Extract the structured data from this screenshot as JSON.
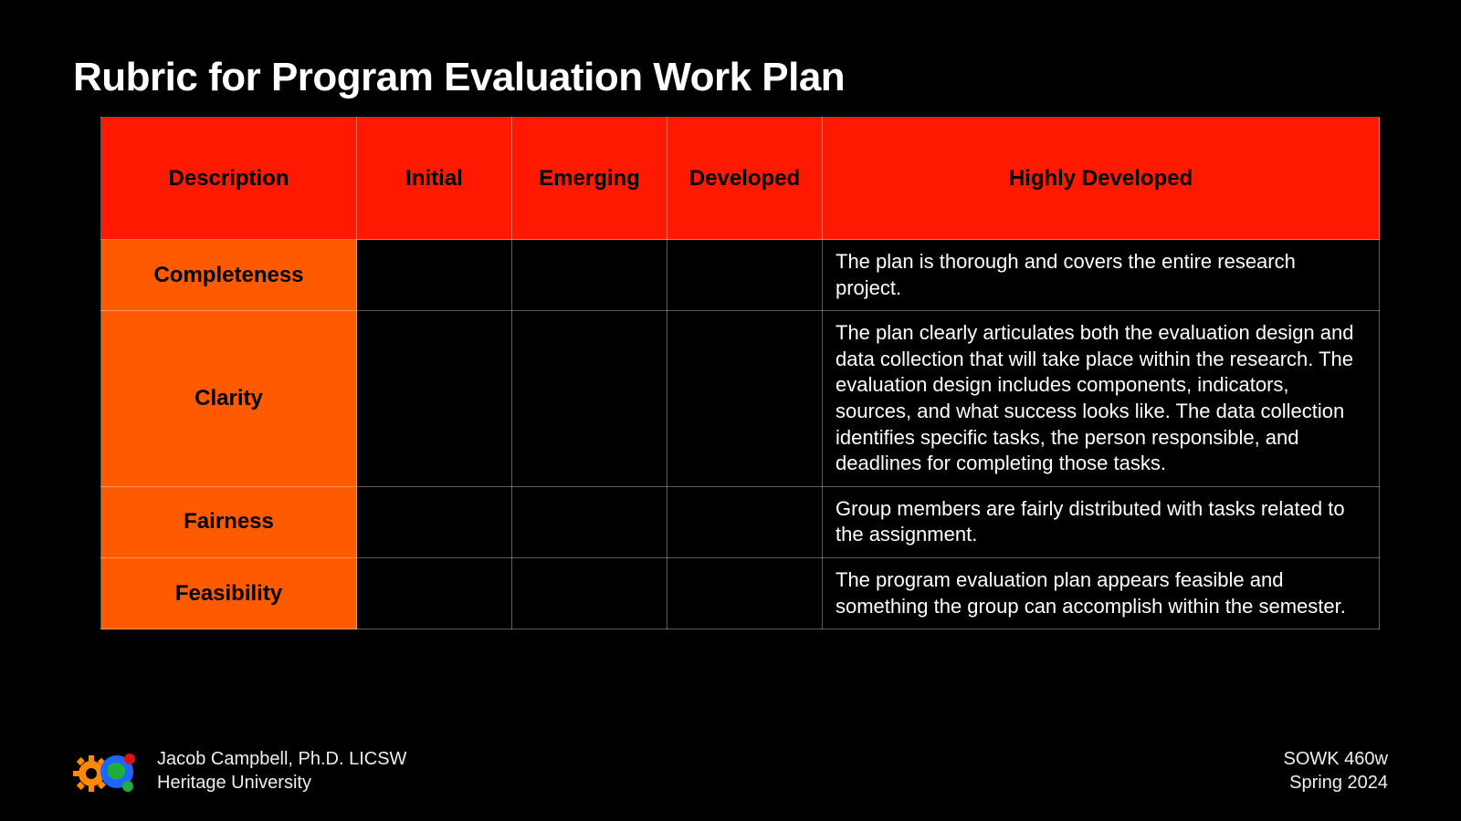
{
  "title": "Rubric for Program Evaluation Work Plan",
  "columns": {
    "c0": "Description",
    "c1": "Initial",
    "c2": "Emerging",
    "c3": "Developed",
    "c4": "Highly Developed"
  },
  "rows": {
    "r0": {
      "label": "Completeness",
      "highly": "The plan is thorough and covers the entire research project."
    },
    "r1": {
      "label": "Clarity",
      "highly": "The plan clearly articulates both the evaluation design and data collection that will take place within the research. The evaluation design includes components, indicators, sources, and what success looks like. The data collection identifies specific tasks, the person responsible, and deadlines for completing those tasks."
    },
    "r2": {
      "label": "Fairness",
      "highly": "Group members are fairly distributed with tasks related to the assignment."
    },
    "r3": {
      "label": "Feasibility",
      "highly": "The program evaluation plan appears feasible and something the group can accomplish within the semester."
    }
  },
  "footer": {
    "author": "Jacob Campbell, Ph.D. LICSW",
    "org": "Heritage University",
    "course": "SOWK 460w",
    "term": "Spring 2024"
  }
}
